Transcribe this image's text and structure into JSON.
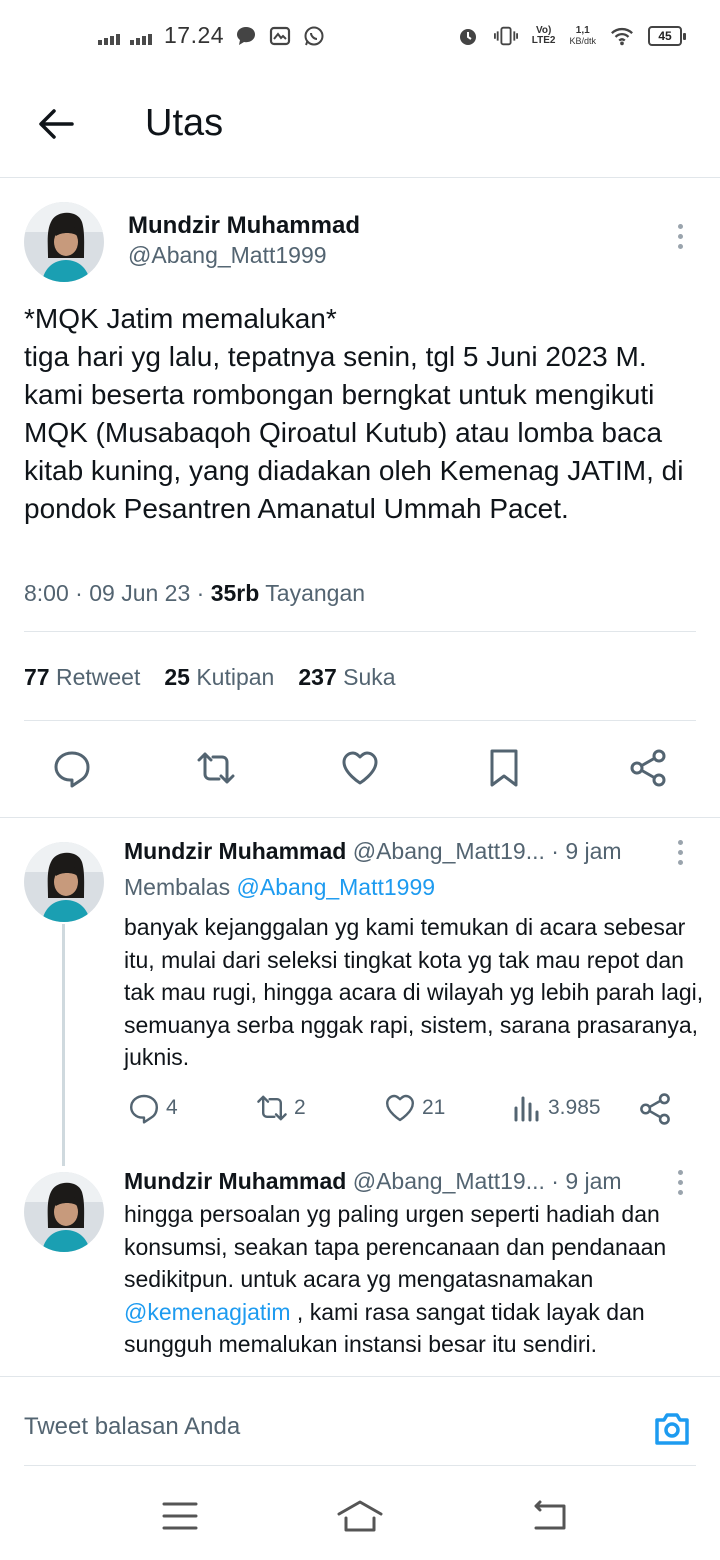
{
  "status_bar": {
    "time": "17.24",
    "network_label": "LTE2",
    "speed_value": "1,1",
    "speed_unit": "KB/dtk",
    "battery": "45"
  },
  "header": {
    "title": "Utas"
  },
  "main_tweet": {
    "name": "Mundzir Muhammad",
    "handle": "@Abang_Matt1999",
    "text_line1": "*MQK Jatim memalukan*",
    "text_rest": "tiga hari yg lalu, tepatnya senin, tgl 5 Juni 2023 M. kami beserta rombongan berngkat untuk mengikuti MQK (Musabaqoh Qiroatul Kutub) atau lomba baca kitab kuning, yang diadakan oleh Kemenag JATIM, di pondok Pesantren Amanatul Ummah Pacet.",
    "time": "8:00",
    "date": "09 Jun 23",
    "views_count": "35rb",
    "views_label": "Tayangan",
    "retweets_count": "77",
    "retweets_label": "Retweet",
    "quotes_count": "25",
    "quotes_label": "Kutipan",
    "likes_count": "237",
    "likes_label": "Suka"
  },
  "replies": [
    {
      "name": "Mundzir Muhammad",
      "handle": "@Abang_Matt19...",
      "time": "9 jam",
      "replying_label": "Membalas",
      "replying_to": "@Abang_Matt1999",
      "text": "banyak kejanggalan yg kami temukan di acara sebesar itu, mulai dari seleksi tingkat kota yg tak mau repot dan tak mau rugi, hingga acara di wilayah yg lebih parah lagi, semuanya serba nggak rapi, sistem, sarana prasaranya, juknis.",
      "replies": "4",
      "retweets": "2",
      "likes": "21",
      "views": "3.985"
    },
    {
      "name": "Mundzir Muhammad",
      "handle": "@Abang_Matt19...",
      "time": "9 jam",
      "text_before": "hingga persoalan yg paling urgen seperti hadiah dan konsumsi, seakan tapa perencanaan dan pendanaan sedikitpun. untuk acara yg mengatasnamakan ",
      "mention": "@kemenagjatim",
      "text_after": " , kami rasa sangat tidak layak dan sungguh memalukan instansi besar itu sendiri."
    }
  ],
  "composer": {
    "placeholder": "Tweet balasan Anda"
  },
  "colors": {
    "accent": "#1d9bf0",
    "text": "#0f1419",
    "secondary": "#536471",
    "divider": "#e1e6ea"
  }
}
